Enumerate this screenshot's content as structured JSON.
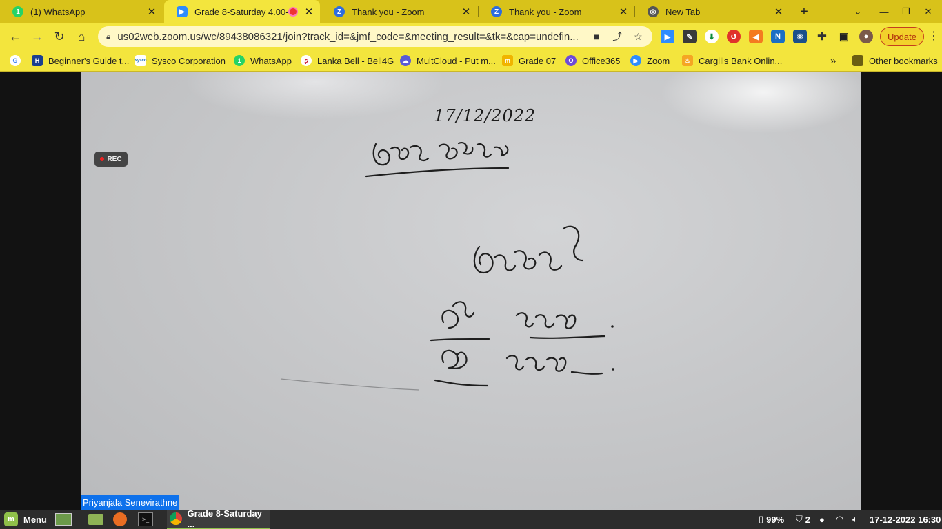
{
  "tabs": [
    {
      "label": "(1) WhatsApp",
      "icon": "whatsapp-icon"
    },
    {
      "label": "Grade 8-Saturday 4.00-5.",
      "icon": "zoom-icon",
      "active": true
    },
    {
      "label": "Thank you - Zoom",
      "icon": "zoom-z-icon"
    },
    {
      "label": "Thank you - Zoom",
      "icon": "zoom-z-icon"
    },
    {
      "label": "New Tab",
      "icon": "chrome-icon"
    }
  ],
  "toolbar": {
    "url": "us02web.zoom.us/wc/89438086321/join?track_id=&jmf_code=&meeting_result=&tk=&cap=undefin...",
    "update_label": "Update"
  },
  "bookmarks": {
    "items": [
      {
        "label": "",
        "icon": "google-icon"
      },
      {
        "label": "Beginner's Guide t...",
        "icon": "h-icon"
      },
      {
        "label": "Sysco Corporation",
        "icon": "sysco-icon"
      },
      {
        "label": "WhatsApp",
        "icon": "whatsapp-icon"
      },
      {
        "label": "Lanka Bell - Bell4G",
        "icon": "lankabell-icon"
      },
      {
        "label": "MultCloud - Put m...",
        "icon": "multcloud-icon"
      },
      {
        "label": "Grade 07",
        "icon": "grade-icon"
      },
      {
        "label": "Office365",
        "icon": "office-icon"
      },
      {
        "label": "Zoom",
        "icon": "zoom-icon"
      },
      {
        "label": "Cargills Bank Onlin...",
        "icon": "cargills-icon"
      }
    ],
    "more": "»",
    "other": "Other bookmarks"
  },
  "video": {
    "rec_label": "REC",
    "participant_name": "Priyanjala Senevirathne",
    "board_date": "17/12/2022"
  },
  "taskbar": {
    "menu_label": "Menu",
    "active_app": "Grade 8-Saturday ...",
    "battery": "99%",
    "updates": "2",
    "datetime": "17-12-2022 16:30"
  }
}
